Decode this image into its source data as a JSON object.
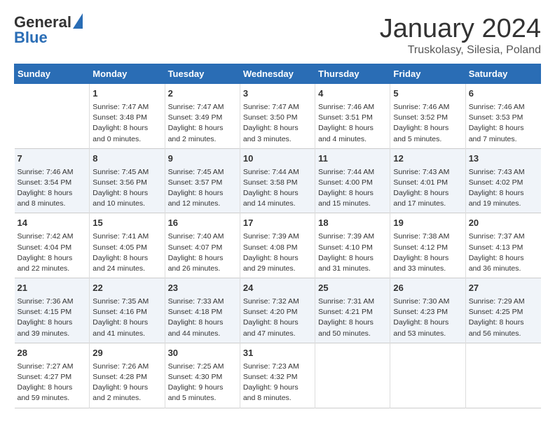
{
  "header": {
    "logo_line1": "General",
    "logo_line2": "Blue",
    "month_title": "January 2024",
    "location": "Truskolasy, Silesia, Poland"
  },
  "columns": [
    "Sunday",
    "Monday",
    "Tuesday",
    "Wednesday",
    "Thursday",
    "Friday",
    "Saturday"
  ],
  "weeks": [
    [
      {
        "day": "",
        "details": ""
      },
      {
        "day": "1",
        "details": "Sunrise: 7:47 AM\nSunset: 3:48 PM\nDaylight: 8 hours\nand 0 minutes."
      },
      {
        "day": "2",
        "details": "Sunrise: 7:47 AM\nSunset: 3:49 PM\nDaylight: 8 hours\nand 2 minutes."
      },
      {
        "day": "3",
        "details": "Sunrise: 7:47 AM\nSunset: 3:50 PM\nDaylight: 8 hours\nand 3 minutes."
      },
      {
        "day": "4",
        "details": "Sunrise: 7:46 AM\nSunset: 3:51 PM\nDaylight: 8 hours\nand 4 minutes."
      },
      {
        "day": "5",
        "details": "Sunrise: 7:46 AM\nSunset: 3:52 PM\nDaylight: 8 hours\nand 5 minutes."
      },
      {
        "day": "6",
        "details": "Sunrise: 7:46 AM\nSunset: 3:53 PM\nDaylight: 8 hours\nand 7 minutes."
      }
    ],
    [
      {
        "day": "7",
        "details": "Sunrise: 7:46 AM\nSunset: 3:54 PM\nDaylight: 8 hours\nand 8 minutes."
      },
      {
        "day": "8",
        "details": "Sunrise: 7:45 AM\nSunset: 3:56 PM\nDaylight: 8 hours\nand 10 minutes."
      },
      {
        "day": "9",
        "details": "Sunrise: 7:45 AM\nSunset: 3:57 PM\nDaylight: 8 hours\nand 12 minutes."
      },
      {
        "day": "10",
        "details": "Sunrise: 7:44 AM\nSunset: 3:58 PM\nDaylight: 8 hours\nand 14 minutes."
      },
      {
        "day": "11",
        "details": "Sunrise: 7:44 AM\nSunset: 4:00 PM\nDaylight: 8 hours\nand 15 minutes."
      },
      {
        "day": "12",
        "details": "Sunrise: 7:43 AM\nSunset: 4:01 PM\nDaylight: 8 hours\nand 17 minutes."
      },
      {
        "day": "13",
        "details": "Sunrise: 7:43 AM\nSunset: 4:02 PM\nDaylight: 8 hours\nand 19 minutes."
      }
    ],
    [
      {
        "day": "14",
        "details": "Sunrise: 7:42 AM\nSunset: 4:04 PM\nDaylight: 8 hours\nand 22 minutes."
      },
      {
        "day": "15",
        "details": "Sunrise: 7:41 AM\nSunset: 4:05 PM\nDaylight: 8 hours\nand 24 minutes."
      },
      {
        "day": "16",
        "details": "Sunrise: 7:40 AM\nSunset: 4:07 PM\nDaylight: 8 hours\nand 26 minutes."
      },
      {
        "day": "17",
        "details": "Sunrise: 7:39 AM\nSunset: 4:08 PM\nDaylight: 8 hours\nand 29 minutes."
      },
      {
        "day": "18",
        "details": "Sunrise: 7:39 AM\nSunset: 4:10 PM\nDaylight: 8 hours\nand 31 minutes."
      },
      {
        "day": "19",
        "details": "Sunrise: 7:38 AM\nSunset: 4:12 PM\nDaylight: 8 hours\nand 33 minutes."
      },
      {
        "day": "20",
        "details": "Sunrise: 7:37 AM\nSunset: 4:13 PM\nDaylight: 8 hours\nand 36 minutes."
      }
    ],
    [
      {
        "day": "21",
        "details": "Sunrise: 7:36 AM\nSunset: 4:15 PM\nDaylight: 8 hours\nand 39 minutes."
      },
      {
        "day": "22",
        "details": "Sunrise: 7:35 AM\nSunset: 4:16 PM\nDaylight: 8 hours\nand 41 minutes."
      },
      {
        "day": "23",
        "details": "Sunrise: 7:33 AM\nSunset: 4:18 PM\nDaylight: 8 hours\nand 44 minutes."
      },
      {
        "day": "24",
        "details": "Sunrise: 7:32 AM\nSunset: 4:20 PM\nDaylight: 8 hours\nand 47 minutes."
      },
      {
        "day": "25",
        "details": "Sunrise: 7:31 AM\nSunset: 4:21 PM\nDaylight: 8 hours\nand 50 minutes."
      },
      {
        "day": "26",
        "details": "Sunrise: 7:30 AM\nSunset: 4:23 PM\nDaylight: 8 hours\nand 53 minutes."
      },
      {
        "day": "27",
        "details": "Sunrise: 7:29 AM\nSunset: 4:25 PM\nDaylight: 8 hours\nand 56 minutes."
      }
    ],
    [
      {
        "day": "28",
        "details": "Sunrise: 7:27 AM\nSunset: 4:27 PM\nDaylight: 8 hours\nand 59 minutes."
      },
      {
        "day": "29",
        "details": "Sunrise: 7:26 AM\nSunset: 4:28 PM\nDaylight: 9 hours\nand 2 minutes."
      },
      {
        "day": "30",
        "details": "Sunrise: 7:25 AM\nSunset: 4:30 PM\nDaylight: 9 hours\nand 5 minutes."
      },
      {
        "day": "31",
        "details": "Sunrise: 7:23 AM\nSunset: 4:32 PM\nDaylight: 9 hours\nand 8 minutes."
      },
      {
        "day": "",
        "details": ""
      },
      {
        "day": "",
        "details": ""
      },
      {
        "day": "",
        "details": ""
      }
    ]
  ]
}
